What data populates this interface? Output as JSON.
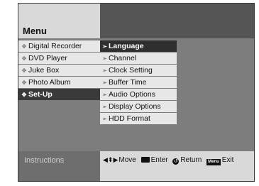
{
  "header": {
    "title": "Menu"
  },
  "left_menu": {
    "items": [
      {
        "label": "Digital Recorder",
        "selected": false
      },
      {
        "label": "DVD Player",
        "selected": false
      },
      {
        "label": "Juke Box",
        "selected": false
      },
      {
        "label": "Photo Album",
        "selected": false
      },
      {
        "label": "Set-Up",
        "selected": true
      }
    ],
    "bullet_icon": "diamond-bullet-icon"
  },
  "submenu": {
    "items": [
      {
        "label": "Language",
        "selected": true
      },
      {
        "label": "Channel",
        "selected": false
      },
      {
        "label": "Clock Setting",
        "selected": false
      },
      {
        "label": "Buffer Time",
        "selected": false
      },
      {
        "label": "Audio Options",
        "selected": false
      },
      {
        "label": "Display Options",
        "selected": false
      },
      {
        "label": "HDD Format",
        "selected": false
      }
    ],
    "arrow_icon": "small-arrow-icon"
  },
  "instructions": {
    "label": "Instructions",
    "move": "Move",
    "enter": "Enter",
    "return": "Return",
    "menu_key": "Menu",
    "exit": "Exit"
  },
  "colors": {
    "frame_dark": "#555555",
    "panel_gray": "#7d7d7d",
    "item_light": "#e7e7e7",
    "selected_dark": "#2f2f2f"
  }
}
